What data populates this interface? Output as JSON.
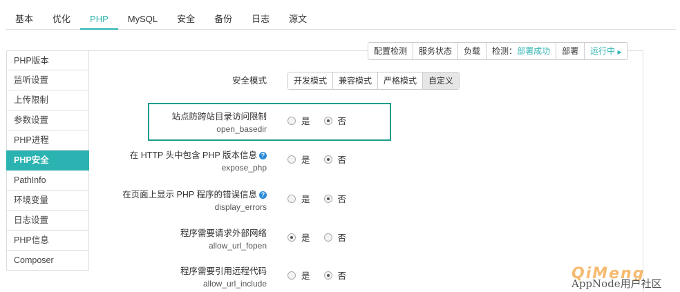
{
  "top_tabs": [
    "基本",
    "优化",
    "PHP",
    "MySQL",
    "安全",
    "备份",
    "日志",
    "源文"
  ],
  "active_top_tab": "PHP",
  "sidebar": {
    "items": [
      {
        "label": "PHP版本",
        "active": false
      },
      {
        "label": "监听设置",
        "active": false
      },
      {
        "label": "上传限制",
        "active": false
      },
      {
        "label": "参数设置",
        "active": false
      },
      {
        "label": "PHP进程",
        "active": false
      },
      {
        "label": "PHP安全",
        "active": true
      },
      {
        "label": "PathInfo",
        "active": false
      },
      {
        "label": "环境变量",
        "active": false
      },
      {
        "label": "日志设置",
        "active": false
      },
      {
        "label": "PHP信息",
        "active": false
      },
      {
        "label": "Composer",
        "active": false
      }
    ]
  },
  "toolbar": {
    "config_check": "配置检测",
    "service_status": "服务状态",
    "load": "负载",
    "detect_label": "检测：",
    "detect_value": "部署成功",
    "deploy": "部署",
    "running": "运行中"
  },
  "security_mode": {
    "label": "安全模式",
    "options": [
      "开发模式",
      "兼容模式",
      "严格模式",
      "自定义"
    ],
    "selected": "自定义"
  },
  "settings": [
    {
      "label": "站点防跨站目录访问限制",
      "key": "open_basedir",
      "value": "否",
      "help": false
    },
    {
      "label": "在 HTTP 头中包含 PHP 版本信息",
      "key": "expose_php",
      "value": "否",
      "help": true
    },
    {
      "label": "在页面上显示 PHP 程序的错误信息",
      "key": "display_errors",
      "value": "否",
      "help": true
    },
    {
      "label": "程序需要请求外部网络",
      "key": "allow_url_fopen",
      "value": "是",
      "help": false
    },
    {
      "label": "程序需要引用远程代码",
      "key": "allow_url_include",
      "value": "否",
      "help": false
    }
  ],
  "radio_options": {
    "yes": "是",
    "no": "否"
  },
  "watermark": {
    "logo": "QiMeng",
    "text": "AppNode用户社区"
  },
  "colors": {
    "accent": "#2bb3b1",
    "highlight_border": "#1f9c8c",
    "help_icon": "#2a8ad8"
  }
}
